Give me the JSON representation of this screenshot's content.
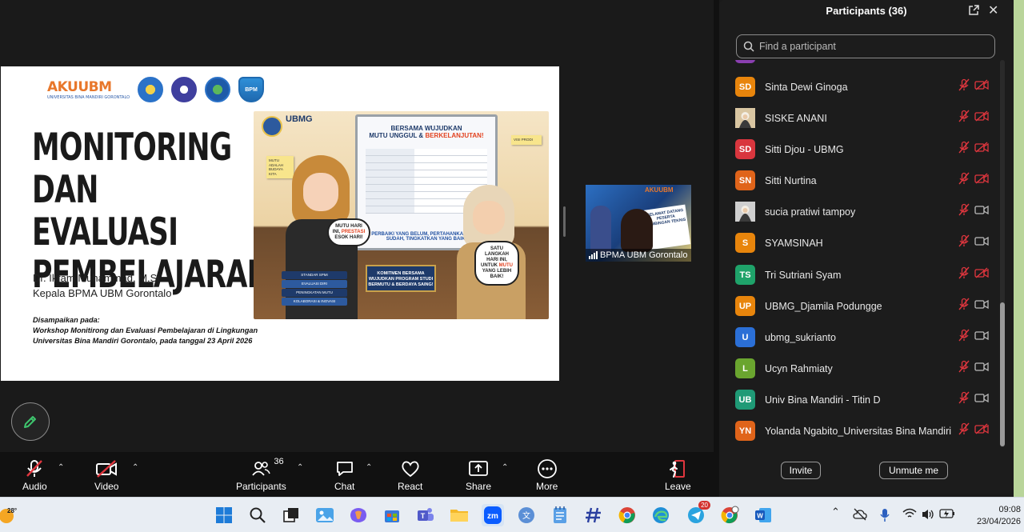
{
  "panel": {
    "title": "Participants (36)",
    "search_placeholder": "Find a participant",
    "invite_label": "Invite",
    "unmute_label": "Unmute me",
    "participants": [
      {
        "initials": "SD",
        "name": "Sinta Dewi Ginoga",
        "color": "#e8850c",
        "avatar": "initials",
        "video": "off"
      },
      {
        "initials": "",
        "name": "SISKE ANANI",
        "color": "#d9c6a2",
        "avatar": "photo",
        "video": "off"
      },
      {
        "initials": "SD",
        "name": "Sitti Djou - UBMG",
        "color": "#d9363e",
        "avatar": "initials",
        "video": "off"
      },
      {
        "initials": "SN",
        "name": "Sitti Nurtina",
        "color": "#e0641a",
        "avatar": "initials",
        "video": "off"
      },
      {
        "initials": "",
        "name": "sucia pratiwi tampoy",
        "color": "#cfcfcf",
        "avatar": "photo",
        "video": "on"
      },
      {
        "initials": "S",
        "name": "SYAMSINAH",
        "color": "#e8850c",
        "avatar": "initials",
        "video": "on"
      },
      {
        "initials": "TS",
        "name": "Tri Sutriani Syam",
        "color": "#1fa36a",
        "avatar": "initials",
        "video": "off"
      },
      {
        "initials": "UP",
        "name": "UBMG_Djamila Podungge",
        "color": "#e8850c",
        "avatar": "initials",
        "video": "on"
      },
      {
        "initials": "U",
        "name": "ubmg_sukrianto",
        "color": "#2b6fd6",
        "avatar": "initials",
        "video": "on"
      },
      {
        "initials": "L",
        "name": "Ucyn Rahmiaty",
        "color": "#6aa52f",
        "avatar": "initials",
        "video": "on"
      },
      {
        "initials": "UB",
        "name": "Univ Bina Mandiri - Titin D",
        "color": "#1f9a76",
        "avatar": "initials",
        "video": "on"
      },
      {
        "initials": "YN",
        "name": "Yolanda Ngabito_Universitas Bina Mandiri",
        "color": "#e0641a",
        "avatar": "initials",
        "video": "off"
      }
    ]
  },
  "slide": {
    "logo_text": "AKUUBM",
    "logo_sub": "UNIVERSITAS BINA MANDIRI GORONTALO",
    "seal_label": "BPM",
    "title": "MONITORING\nDAN EVALUASI\nPEMBELAJARAN",
    "presenter_name": "Dr. Ikram Muhammad, M.Si",
    "presenter_role": "Kepala BPMA UBM Gorontalo",
    "occasion_label": "Disampaikan pada:",
    "occasion_line1": "Workshop Monitirong dan Evaluasi Pembelajaran di Lingkungan",
    "occasion_line2": "Universitas Bina Mandiri Gorontalo, pada tanggal 23 April 2026",
    "poster": {
      "brand": "UBMG",
      "board_heading_1": "BERSAMA WUJUDKAN",
      "board_heading_2a": "MUTU UNGGUL & ",
      "board_heading_2b": "BERKELANJUTAN!",
      "board_footer": "PERBAIKI YANG BELUM, PERTAHANKAN YANG SUDAH, TINGKATKAN YANG BAIK!",
      "bubble_left_a": "MUTU HARI INI,",
      "bubble_left_b": "PRESTASI",
      "bubble_left_c": "ESOK HARI!",
      "bubble_right_a": "SATU LANGKAH HARI INI, UNTUK",
      "bubble_right_b": "MUTU",
      "bubble_right_c": "YANG LEBIH BAIK!",
      "plaque": "KOMITMEN BERSAMA WUJUDKAN PROGRAM STUDI BERMUTU & BERDAYA SAING!",
      "note_left": "MUTU ADALAH BUDAYA KITA",
      "note_right": "VISI PRODI",
      "books": [
        "STANDAR SPMI",
        "EVALUASI DIRI",
        "PENINGKATAN MUTU",
        "KOLABORASI & INOVASI"
      ]
    }
  },
  "video_tile": {
    "name": "BPMA UBM Gorontalo",
    "banner": "AKUUBM",
    "sign_text": "SELAMAT DATANG PESERTA BIMBINGAN TEKNIS"
  },
  "toolbar": {
    "audio_label": "Audio",
    "video_label": "Video",
    "participants_label": "Participants",
    "participants_count": "36",
    "chat_label": "Chat",
    "react_label": "React",
    "share_label": "Share",
    "more_label": "More",
    "leave_label": "Leave"
  },
  "taskbar": {
    "temperature": "28°",
    "chrome_badge": "20",
    "time": "09:08",
    "date": "23/04/2026"
  }
}
